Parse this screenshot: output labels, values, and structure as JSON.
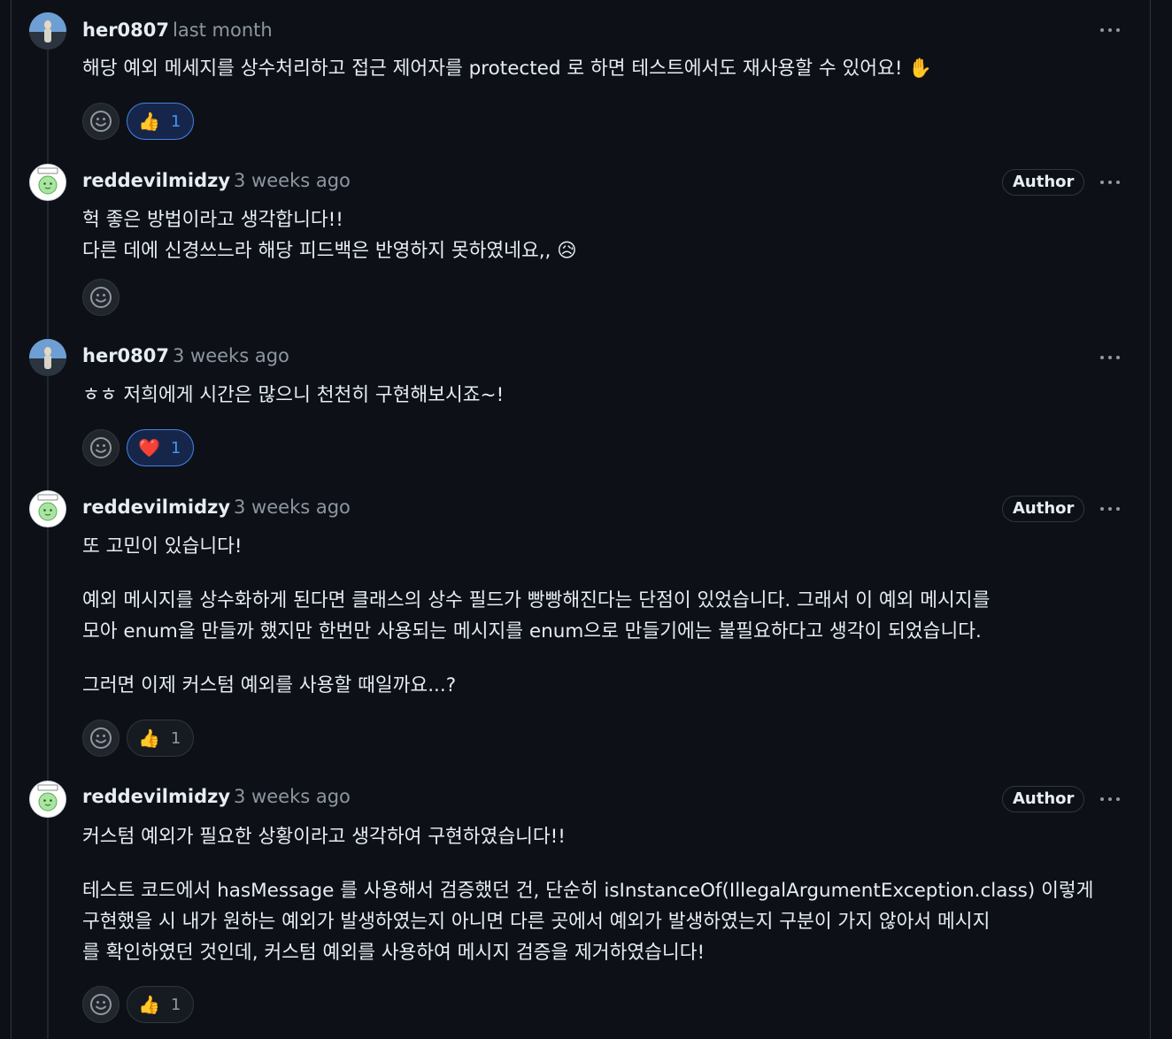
{
  "comments": [
    {
      "author": "her0807",
      "time": "last month",
      "paragraphs": [
        "해당 예외 메세지를 상수처리하고 접근 제어자를 protected 로 하면 테스트에서도 재사용할 수 있어요! ✋"
      ],
      "reaction": {
        "emoji": "👍",
        "count": "1",
        "active": true
      }
    },
    {
      "author": "reddevilmidzy",
      "time": "3 weeks ago",
      "badge": "Author",
      "paragraphs": [
        "헉 좋은 방법이라고 생각합니다!!",
        "다른 데에 신경쓰느라 해당 피드백은 반영하지 못하였네요,, 😥"
      ]
    },
    {
      "author": "her0807",
      "time": "3 weeks ago",
      "paragraphs": [
        "ㅎㅎ 저희에게 시간은 많으니 천천히 구현해보시죠~!"
      ],
      "reaction": {
        "emoji": "❤️",
        "count": "1",
        "active": true
      }
    },
    {
      "author": "reddevilmidzy",
      "time": "3 weeks ago",
      "badge": "Author",
      "paragraphs": [
        "또 고민이 있습니다!",
        "예외 메시지를 상수화하게 된다면 클래스의 상수 필드가 빵빵해진다는 단점이 있었습니다. 그래서 이 예외 메시지를",
        "모아 enum을 만들까 했지만 한번만 사용되는 메시지를 enum으로 만들기에는 불필요하다고 생각이 되었습니다.",
        "그러면 이제 커스텀 예외를 사용할 때일까요...?"
      ],
      "reaction": {
        "emoji": "👍",
        "count": "1",
        "active": false
      }
    },
    {
      "author": "reddevilmidzy",
      "time": "3 weeks ago",
      "badge": "Author",
      "paragraphs": [
        "커스텀 예외가 필요한 상황이라고 생각하여 구현하였습니다!!",
        "테스트 코드에서 hasMessage 를 사용해서 검증했던 건, 단순히 isInstanceOf(IllegalArgumentException.class) 이렇게",
        "구현했을 시 내가 원하는 예외가 발생하였는지 아니면 다른 곳에서 예외가 발생하였는지 구분이 가지 않아서 메시지",
        "를 확인하였던 것인데, 커스텀 예외를 사용하여 메시지 검증을 제거하였습니다!"
      ],
      "reaction": {
        "emoji": "👍",
        "count": "1",
        "active": false
      }
    }
  ],
  "icons": {
    "add_reaction": "smiley-icon",
    "menu": "kebab-horizontal-icon"
  },
  "colors": {
    "background": "#0d1117",
    "text": "#e6edf3",
    "muted": "#8d96a0",
    "active_reaction_border": "#4184e4"
  }
}
